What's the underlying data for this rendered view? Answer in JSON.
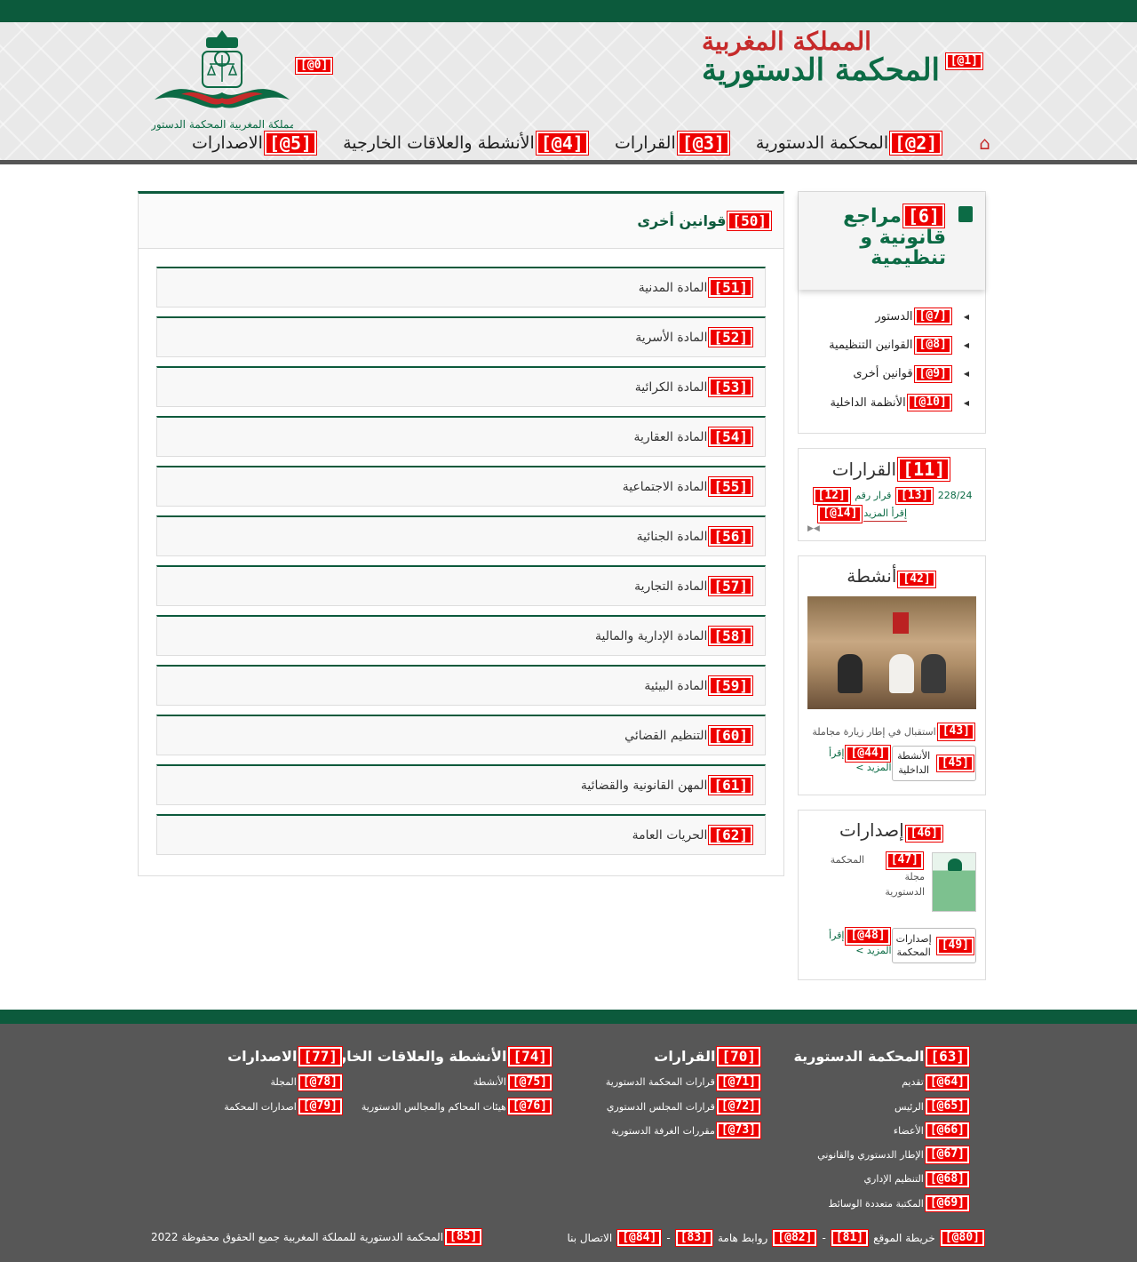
{
  "header": {
    "title_line1": "المملكة المغربية",
    "title_line2": "المحكمة الدستورية",
    "title_marker": "[1@]",
    "logo_marker": "[0@]",
    "logo_caption": "المملكة المغربية المحكمة الدستورية",
    "nav": [
      {
        "marker": "[2@]",
        "label": "المحكمة الدستورية"
      },
      {
        "marker": "[3@]",
        "label": "القرارات"
      },
      {
        "marker": "[4@]",
        "label": "الأنشطة والعلاقات الخارجية"
      },
      {
        "marker": "[5@]",
        "label": "الاصدارات"
      }
    ]
  },
  "sidebar": {
    "references": {
      "marker": "[6]",
      "title": "مراجع قانونية و تنظيمية",
      "items": [
        {
          "marker": "[7@]",
          "label": "الدستور"
        },
        {
          "marker": "[8@]",
          "label": "القوانين التنظيمية"
        },
        {
          "marker": "[9@]",
          "label": "قوانين أخرى"
        },
        {
          "marker": "[10@]",
          "label": "الأنظمة الداخلية"
        }
      ]
    },
    "decisions": {
      "marker": "[11]",
      "title": "القرارات",
      "decision_marker_a": "[12]",
      "decision_marker_b": "[13]",
      "decision_label": "قرار رقم",
      "decision_number": "228/24",
      "more_marker": "[14@]",
      "more_label": "إقرأ المزيد"
    },
    "activities": {
      "marker": "[42]",
      "title": "أنشطة",
      "caption_marker": "[43]",
      "caption": "استقبال في إطار زيارة مجاملة",
      "more_marker": "[44@]",
      "more_label": "إقرأ المزيد >",
      "button_marker": "[45]",
      "button_label": "الأنشطة الداخلية"
    },
    "publications": {
      "marker": "[46]",
      "title": "إصدارات",
      "item_marker": "[47]",
      "item_title_a": "مجلة",
      "item_title_b": "المحكمة",
      "item_title_c": "الدستورية",
      "more_marker": "[48@]",
      "more_label": "إقرأ المزيد >",
      "button_marker": "[49]",
      "button_label": "إصدارات المحكمة"
    }
  },
  "main": {
    "marker": "[50]",
    "title": "قوانين أخرى",
    "items": [
      {
        "marker": "[51]",
        "label": "المادة المدنية"
      },
      {
        "marker": "[52]",
        "label": "المادة الأسرية"
      },
      {
        "marker": "[53]",
        "label": "المادة الكرائية"
      },
      {
        "marker": "[54]",
        "label": "المادة العقارية"
      },
      {
        "marker": "[55]",
        "label": "المادة الاجتماعية"
      },
      {
        "marker": "[56]",
        "label": "المادة الجنائية"
      },
      {
        "marker": "[57]",
        "label": "المادة التجارية"
      },
      {
        "marker": "[58]",
        "label": "المادة الإدارية والمالية"
      },
      {
        "marker": "[59]",
        "label": "المادة البيئية"
      },
      {
        "marker": "[60]",
        "label": "التنظيم القضائي"
      },
      {
        "marker": "[61]",
        "label": "المهن القانونية والقضائية"
      },
      {
        "marker": "[62]",
        "label": "الحريات العامة"
      }
    ]
  },
  "footer": {
    "col1": {
      "marker": "[63]",
      "title": "المحكمة الدستورية",
      "links": [
        {
          "marker": "[64@]",
          "label": "تقديم"
        },
        {
          "marker": "[65@]",
          "label": "الرئيس"
        },
        {
          "marker": "[66@]",
          "label": "الأعضاء"
        },
        {
          "marker": "[67@]",
          "label": "الإطار الدستوري والقانوني"
        },
        {
          "marker": "[68@]",
          "label": "التنظيم الإداري"
        },
        {
          "marker": "[69@]",
          "label": "المكتبة متعددة الوسائط"
        }
      ]
    },
    "col2": {
      "marker": "[70]",
      "title": "القرارات",
      "links": [
        {
          "marker": "[71@]",
          "label": "قرارات المحكمة الدستورية"
        },
        {
          "marker": "[72@]",
          "label": "قرارات المجلس الدستوري"
        },
        {
          "marker": "[73@]",
          "label": "مقررات الغرفة الدستورية"
        }
      ]
    },
    "col3": {
      "marker": "[74]",
      "title": "الأنشطة والعلاقات الخارجية",
      "links": [
        {
          "marker": "[75@]",
          "label": "الأنشطة"
        },
        {
          "marker": "[76@]",
          "label": "هيئات المحاكم والمجالس الدستورية"
        }
      ]
    },
    "col4": {
      "marker": "[77]",
      "title": "الاصدارات",
      "links": [
        {
          "marker": "[78@]",
          "label": "المجلة"
        },
        {
          "marker": "[79@]",
          "label": "اصدارات المحكمة"
        }
      ]
    },
    "bottom": {
      "sitemap_marker": "[80@]",
      "sitemap": "خريطة الموقع",
      "sep1_marker": "[81]",
      "links_marker": "[82@]",
      "links": "روابط هامة",
      "sep2_marker": "[83]",
      "contact_marker": "[84@]",
      "contact": "الاتصال بنا",
      "copy_marker": "[85]",
      "copyright": "المحكمة الدستورية للمملكة المغربية جميع الحقوق محفوظة 2022"
    }
  }
}
